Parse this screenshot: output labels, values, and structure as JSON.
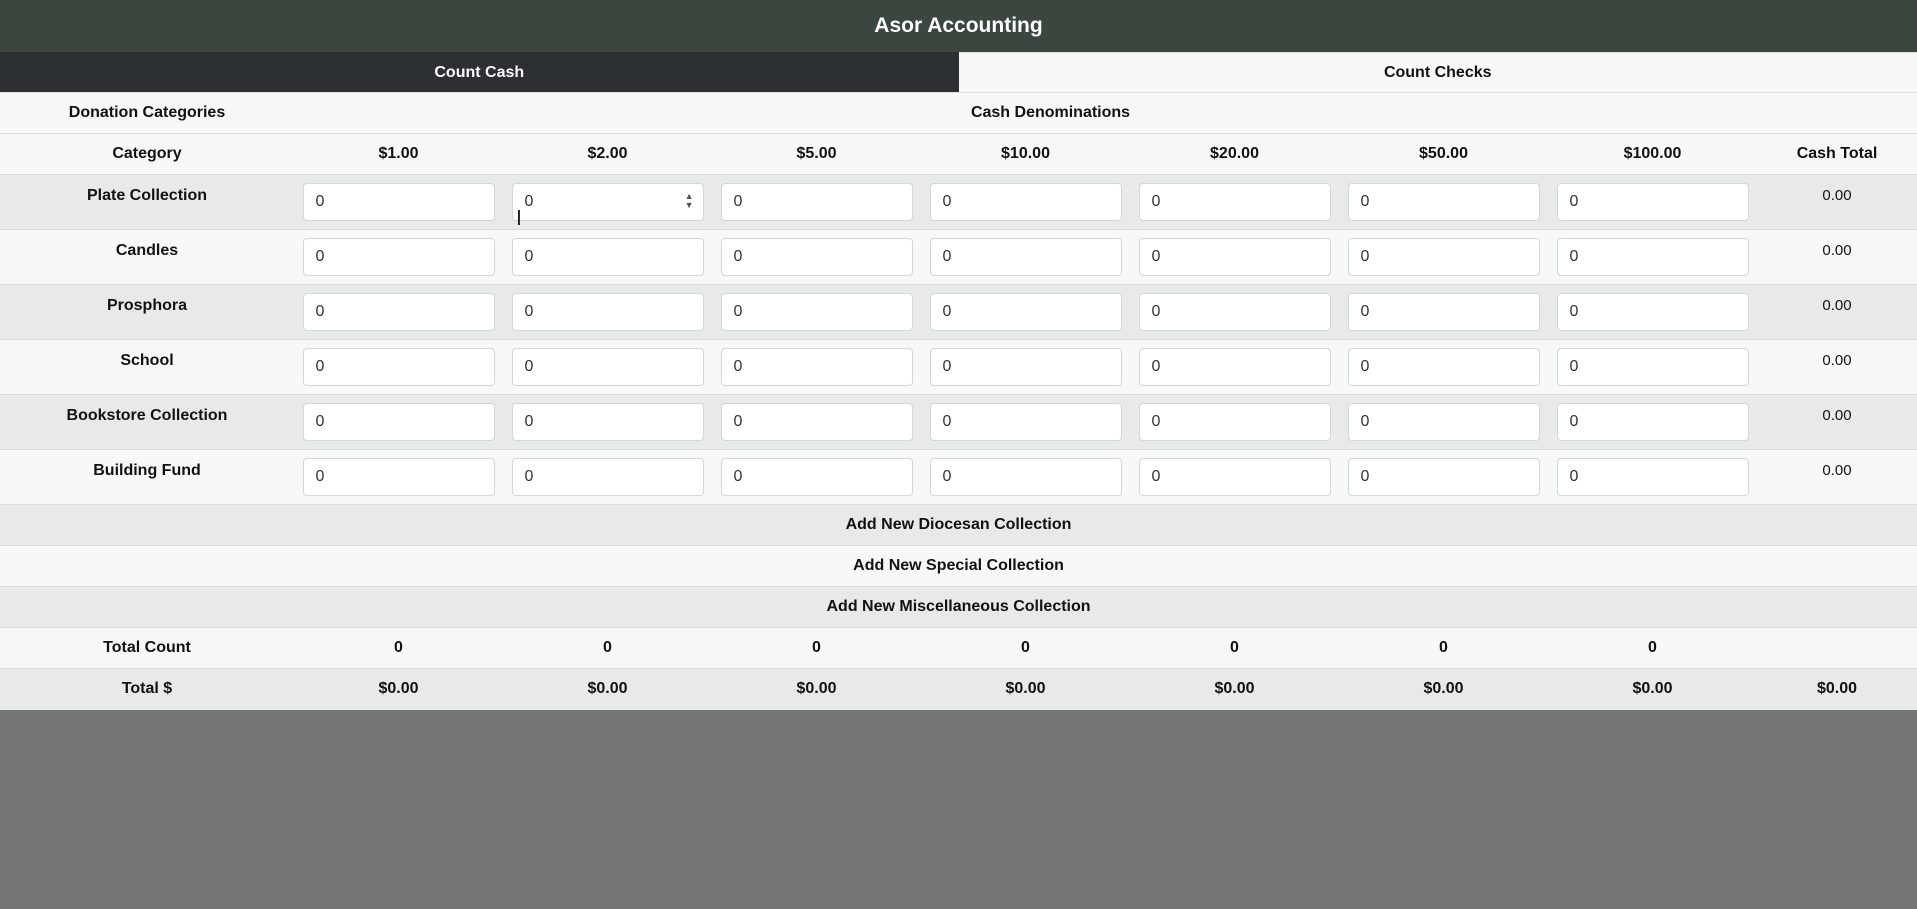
{
  "app": {
    "title": "Asor Accounting"
  },
  "tabs": [
    {
      "label": "Count Cash",
      "active": true
    },
    {
      "label": "Count Checks",
      "active": false
    }
  ],
  "table": {
    "section_left": "Donation Categories",
    "section_right": "Cash Denominations",
    "columns": {
      "category": "Category",
      "denominations": [
        "$1.00",
        "$2.00",
        "$5.00",
        "$10.00",
        "$20.00",
        "$50.00",
        "$100.00"
      ],
      "cash_total": "Cash Total"
    },
    "rows": [
      {
        "category": "Plate Collection",
        "values": [
          "0",
          "0",
          "0",
          "0",
          "0",
          "0",
          "0"
        ],
        "total": "0.00"
      },
      {
        "category": "Candles",
        "values": [
          "0",
          "0",
          "0",
          "0",
          "0",
          "0",
          "0"
        ],
        "total": "0.00"
      },
      {
        "category": "Prosphora",
        "values": [
          "0",
          "0",
          "0",
          "0",
          "0",
          "0",
          "0"
        ],
        "total": "0.00"
      },
      {
        "category": "School",
        "values": [
          "0",
          "0",
          "0",
          "0",
          "0",
          "0",
          "0"
        ],
        "total": "0.00"
      },
      {
        "category": "Bookstore Collection",
        "values": [
          "0",
          "0",
          "0",
          "0",
          "0",
          "0",
          "0"
        ],
        "total": "0.00"
      },
      {
        "category": "Building Fund",
        "values": [
          "0",
          "0",
          "0",
          "0",
          "0",
          "0",
          "0"
        ],
        "total": "0.00"
      }
    ],
    "actions": {
      "add_diocesan": "Add New Diocesan Collection",
      "add_special": "Add New Special Collection",
      "add_misc": "Add New Miscellaneous Collection"
    },
    "total_count": {
      "label": "Total Count",
      "values": [
        "0",
        "0",
        "0",
        "0",
        "0",
        "0",
        "0"
      ]
    },
    "total_dollars": {
      "label": "Total $",
      "values": [
        "$0.00",
        "$0.00",
        "$0.00",
        "$0.00",
        "$0.00",
        "$0.00",
        "$0.00"
      ],
      "grand_total": "$0.00"
    }
  },
  "colors": {
    "header_bg": "#3b463e",
    "active_tab_bg": "#2c3033",
    "page_bg": "#757575"
  }
}
